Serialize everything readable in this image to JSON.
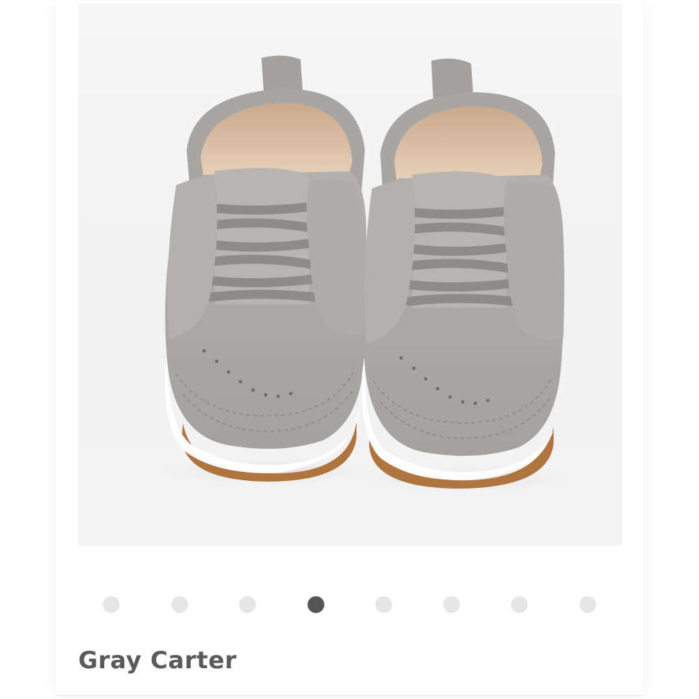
{
  "product": {
    "title": "Gray Carter",
    "image_subject": "gray-leather-baby-sneakers"
  },
  "carousel": {
    "total": 8,
    "active_index": 4
  },
  "colors": {
    "shoe_leather": "#a9a7a3",
    "elastic_laces": "#8e8b88",
    "lining": "#e1c4a8",
    "sole_white": "#ffffff",
    "sole_tan": "#b0743f",
    "dot_inactive": "#e6e6e6",
    "dot_active": "#555555",
    "title_text": "#5a5a5a"
  }
}
